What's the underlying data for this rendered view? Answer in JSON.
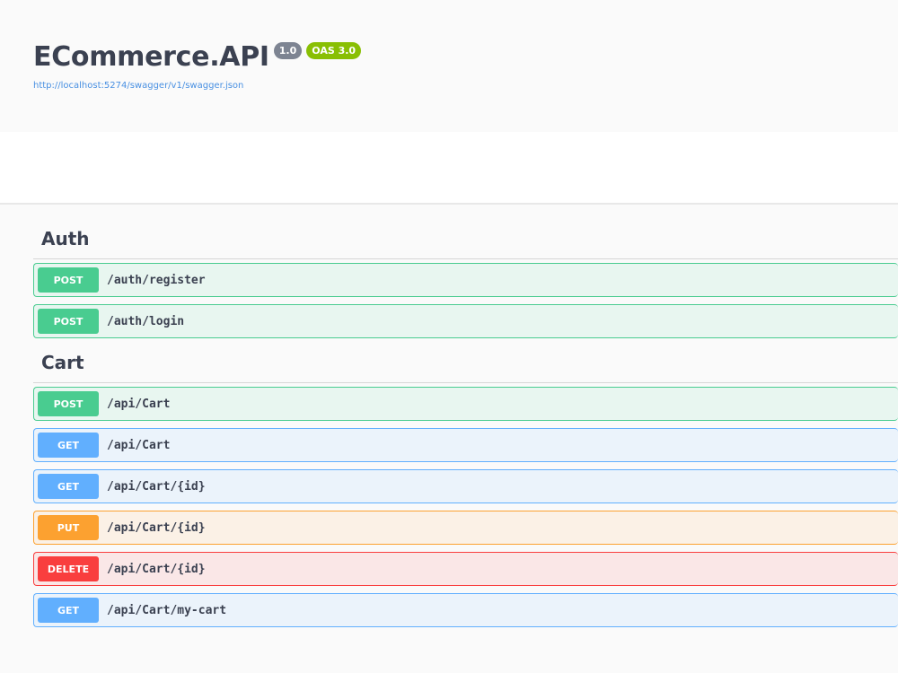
{
  "info": {
    "title": "ECommerce.API",
    "version": "1.0",
    "oas": "OAS 3.0",
    "spec_url": "http://localhost:5274/swagger/v1/swagger.json"
  },
  "colors": {
    "post": "#49cc90",
    "get": "#61affe",
    "put": "#fca130",
    "delete": "#f93e3e",
    "link": "#4990e2"
  },
  "tags": [
    {
      "name": "Auth",
      "operations": [
        {
          "method": "POST",
          "path": "/auth/register"
        },
        {
          "method": "POST",
          "path": "/auth/login"
        }
      ]
    },
    {
      "name": "Cart",
      "operations": [
        {
          "method": "POST",
          "path": "/api/Cart"
        },
        {
          "method": "GET",
          "path": "/api/Cart"
        },
        {
          "method": "GET",
          "path": "/api/Cart/{id}"
        },
        {
          "method": "PUT",
          "path": "/api/Cart/{id}"
        },
        {
          "method": "DELETE",
          "path": "/api/Cart/{id}"
        },
        {
          "method": "GET",
          "path": "/api/Cart/my-cart"
        }
      ]
    }
  ]
}
